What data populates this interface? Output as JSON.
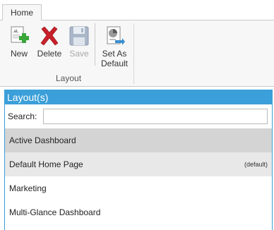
{
  "ribbon": {
    "tab": "Home",
    "buttons": {
      "new": "New",
      "delete": "Delete",
      "save": "Save",
      "set_default_line1": "Set As",
      "set_default_line2": "Default"
    },
    "group_label": "Layout",
    "icons": {
      "new": "new-layout-icon",
      "delete": "delete-x-icon",
      "save": "floppy-disk-icon",
      "set_default": "chart-page-icon"
    }
  },
  "panel": {
    "title": "Layout(s)",
    "search_label": "Search:",
    "search_value": "",
    "items": [
      {
        "label": "Active Dashboard",
        "badge": ""
      },
      {
        "label": "Default Home Page",
        "badge": "(default)"
      },
      {
        "label": "Marketing",
        "badge": ""
      },
      {
        "label": "Multi-Glance Dashboard",
        "badge": ""
      }
    ]
  },
  "colors": {
    "accent": "#3b9fd9",
    "selected_row": "#d4d4d4",
    "hover_row": "#e8e8e8",
    "new_plus": "#3aa63a",
    "delete_x": "#c8202a"
  }
}
